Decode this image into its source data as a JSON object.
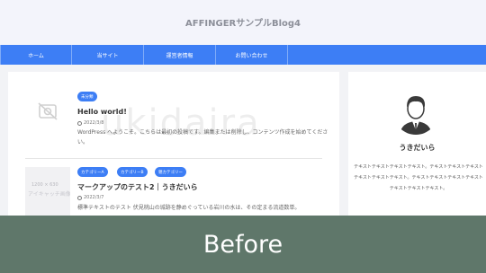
{
  "header": {
    "site_title": "AFFINGERサンプルBlog4"
  },
  "nav": {
    "items": [
      {
        "label": "ホーム"
      },
      {
        "label": "当サイト"
      },
      {
        "label": "運営者情報"
      },
      {
        "label": "お問い合わせ"
      }
    ]
  },
  "watermark": {
    "text": "ukidaira"
  },
  "posts": [
    {
      "categories": [
        "未分類"
      ],
      "title": "Hello world!",
      "date": "2022/3/8",
      "excerpt": "WordPress へようこそ。こちらは最初の投稿です。編集または削除し、コンテンツ作成を始めてください。"
    },
    {
      "thumb_text_1": "1200 × 630",
      "thumb_text_2": "アイキャッチ画像",
      "categories": [
        "カテゴリーA",
        "カテゴリーB",
        "親カテゴリー"
      ],
      "title": "マークアップのテスト2｜うきだいら",
      "date": "2022/3/7",
      "excerpt": "標準テキストのテスト 伏見桃山の城跡を静めぐっている岩川の水は、その定まる流道数単。"
    }
  ],
  "sidebar": {
    "author_name": "うきだいら",
    "author_bio": "テキストテキストテキストテキスト。テキストテキストテキストテキストテキストテキスト。テキストテキストテキストテキストテキストテキストテキスト。"
  },
  "overlay": {
    "label": "Before"
  },
  "colors": {
    "accent": "#3d7ef5",
    "overlay": "#5f776a",
    "header_bg": "#f3f4fb"
  }
}
